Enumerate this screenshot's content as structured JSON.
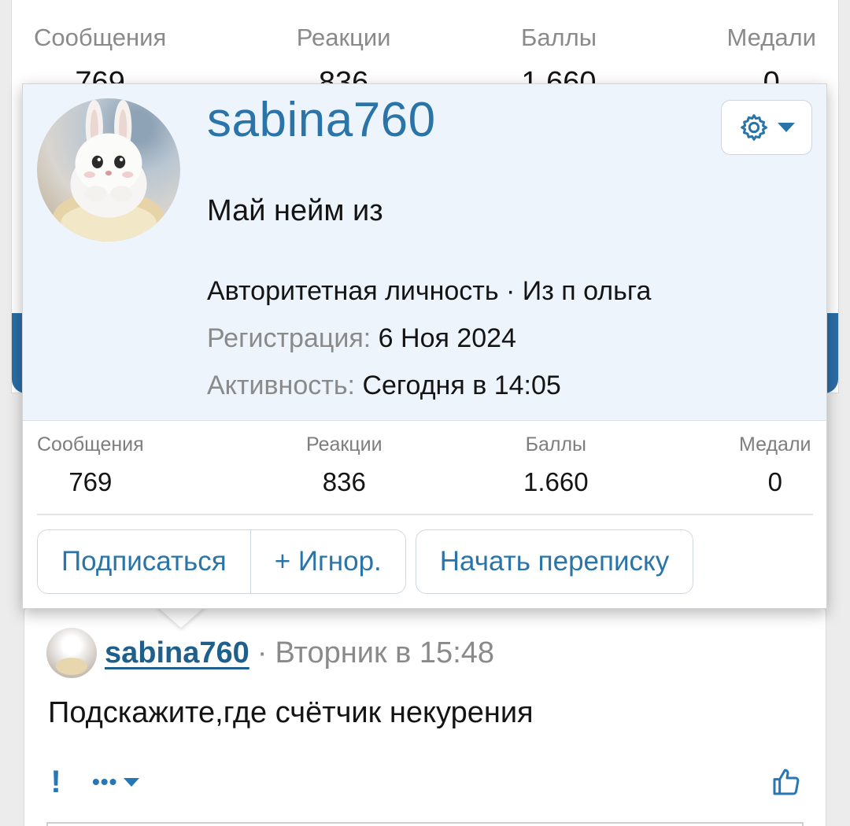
{
  "background_profile": {
    "stats": [
      {
        "label": "Сообщения",
        "value": "769"
      },
      {
        "label": "Реакции",
        "value": "836"
      },
      {
        "label": "Баллы",
        "value": "1.660"
      },
      {
        "label": "Медали",
        "value": "0"
      }
    ]
  },
  "popup": {
    "username": "sabina760",
    "avatar_icon": "bunny-avatar",
    "settings_icon": "gear-icon",
    "status": "Май нейм из",
    "title_line": "Авторитетная личность · Из п ольга",
    "registration_label": "Регистрация:",
    "registration_value": "6 Ноя 2024",
    "activity_label": "Активность:",
    "activity_value": "Сегодня в 14:05",
    "stats": [
      {
        "label": "Сообщения",
        "value": "769"
      },
      {
        "label": "Реакции",
        "value": "836"
      },
      {
        "label": "Баллы",
        "value": "1.660"
      },
      {
        "label": "Медали",
        "value": "0"
      }
    ],
    "buttons": {
      "follow": "Подписаться",
      "ignore": "+ Игнор.",
      "start_conversation": "Начать переписку"
    }
  },
  "post": {
    "username": "sabina760",
    "separator": "·",
    "time": "Вторник в 15:48",
    "text": "Подскажите,где счётчик некурения",
    "report_label": "!",
    "more_label": "•••",
    "like_icon": "thumbs-up-icon"
  },
  "colors": {
    "accent": "#2a74a8",
    "popup_background": "#edf4fc",
    "muted_text": "#8a8a8a"
  }
}
